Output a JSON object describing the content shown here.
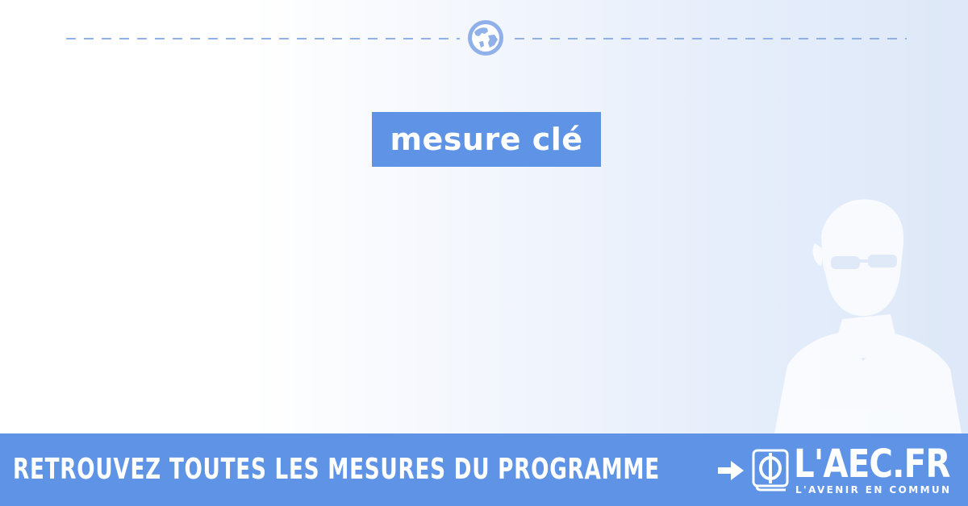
{
  "header": {
    "divider_icon": "globe-icon"
  },
  "badge": {
    "label": "mesure clé"
  },
  "portrait": {
    "icon": "portrait-silhouette"
  },
  "banner": {
    "text": "RETROUVEZ TOUTES LES MESURES DU PROGRAMME",
    "arrow_icon": "arrow-right-icon",
    "brand_icon": "phi-book-icon",
    "brand_name": "L'AEC.FR",
    "brand_tagline": "L'AVENIR EN COMMUN"
  },
  "colors": {
    "accent": "#5e93e6",
    "divider": "#8fb0e8",
    "portrait": "#ffffff"
  }
}
